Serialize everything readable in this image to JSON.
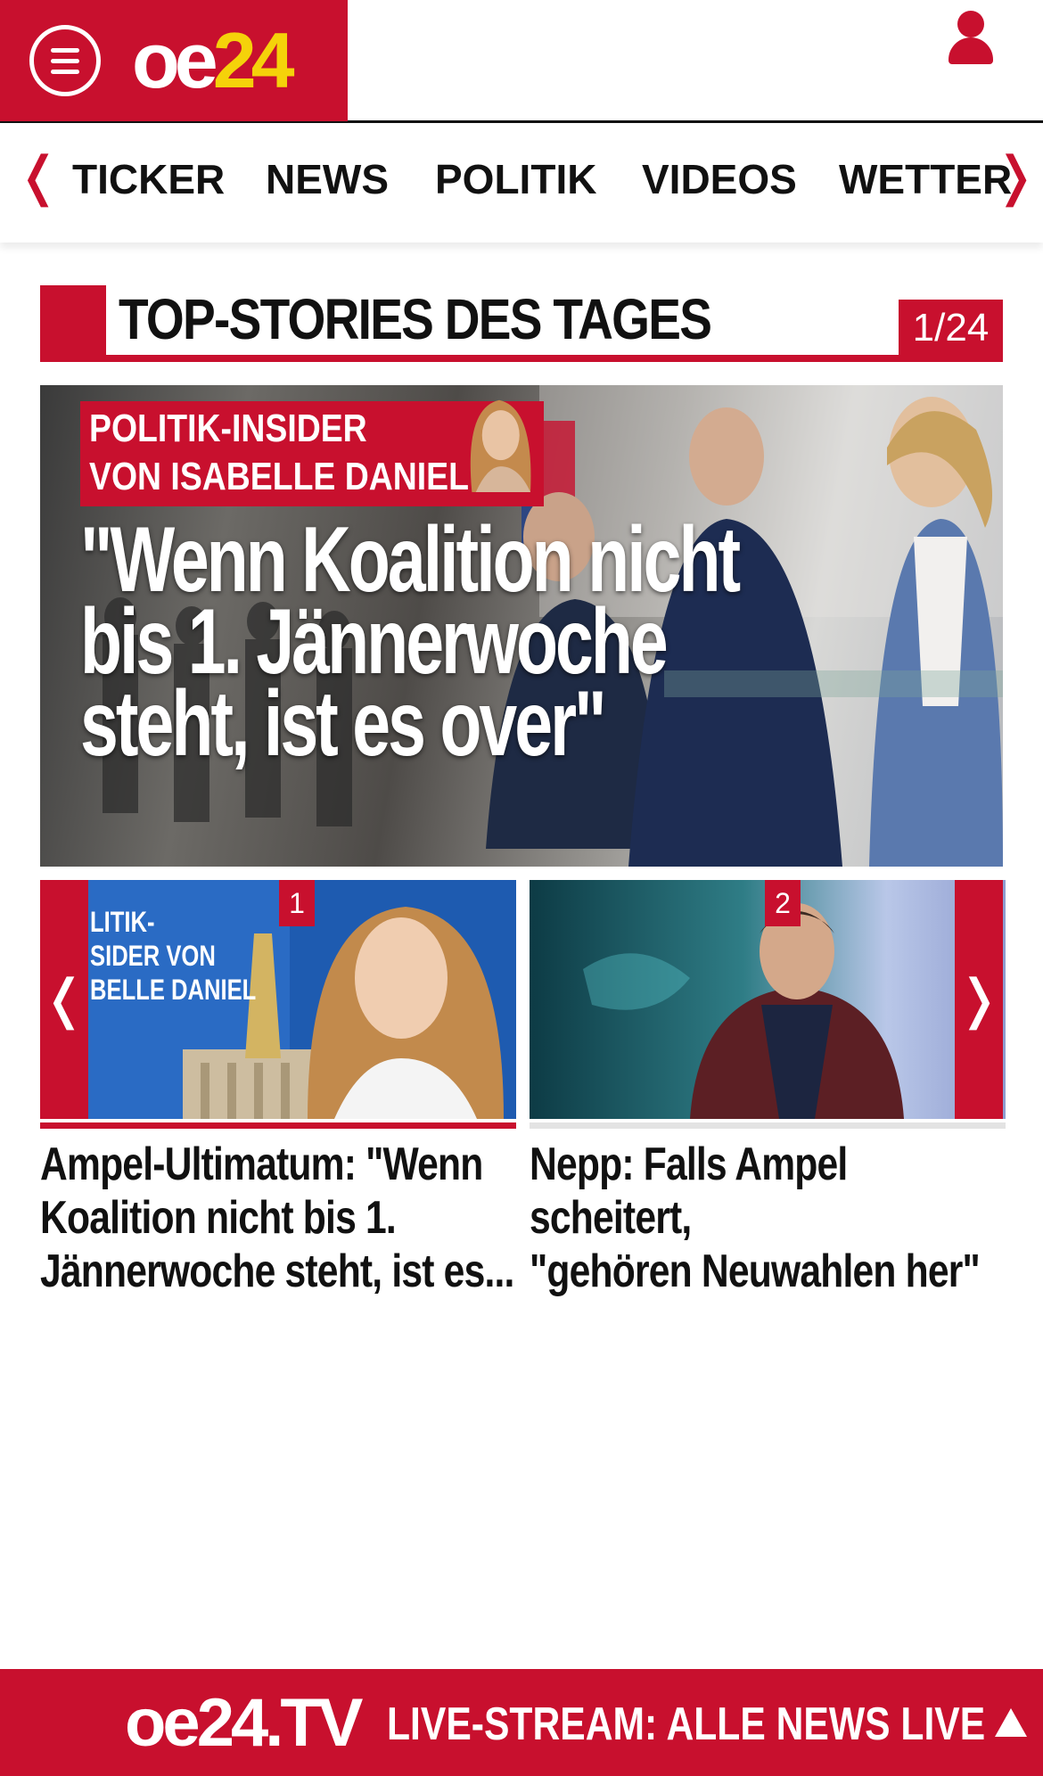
{
  "header": {
    "logo_part1": "oe",
    "logo_part2": "24"
  },
  "nav": {
    "items": [
      "TICKER",
      "NEWS",
      "POLITIK",
      "VIDEOS",
      "WETTER"
    ],
    "prev_icon": "chevron-left-icon",
    "next_icon": "chevron-right-icon"
  },
  "section": {
    "title": "TOP-STORIES DES TAGES",
    "counter": "1/24"
  },
  "hero": {
    "badge_line1": "POLITIK-INSIDER",
    "badge_line2": "VON ISABELLE DANIEL",
    "headline_line1": "\"Wenn Koalition nicht",
    "headline_line2": "bis 1. Jännerwoche",
    "headline_line3": "steht, ist es over\""
  },
  "cards": [
    {
      "number": "1",
      "thumb_text_line1": "LITIK-",
      "thumb_text_line2": "SIDER VON",
      "thumb_text_line3": "BELLE DANIEL",
      "caption_line1": "Ampel-Ultimatum: \"Wenn",
      "caption_line2": "Koalition nicht bis 1.",
      "caption_line3": "Jännerwoche steht, ist es..."
    },
    {
      "number": "2",
      "caption_line1": "Nepp: Falls Ampel scheitert,",
      "caption_line2": "\"gehören Neuwahlen her\""
    }
  ],
  "slider": {
    "prev_symbol": "❬",
    "next_symbol": "❭"
  },
  "footer": {
    "logo": "oe24.TV",
    "live_text": "LIVE-STREAM:  ALLE NEWS LIVE"
  },
  "colors": {
    "brand_red": "#c8102e",
    "logo_yellow": "#f5d20a"
  }
}
